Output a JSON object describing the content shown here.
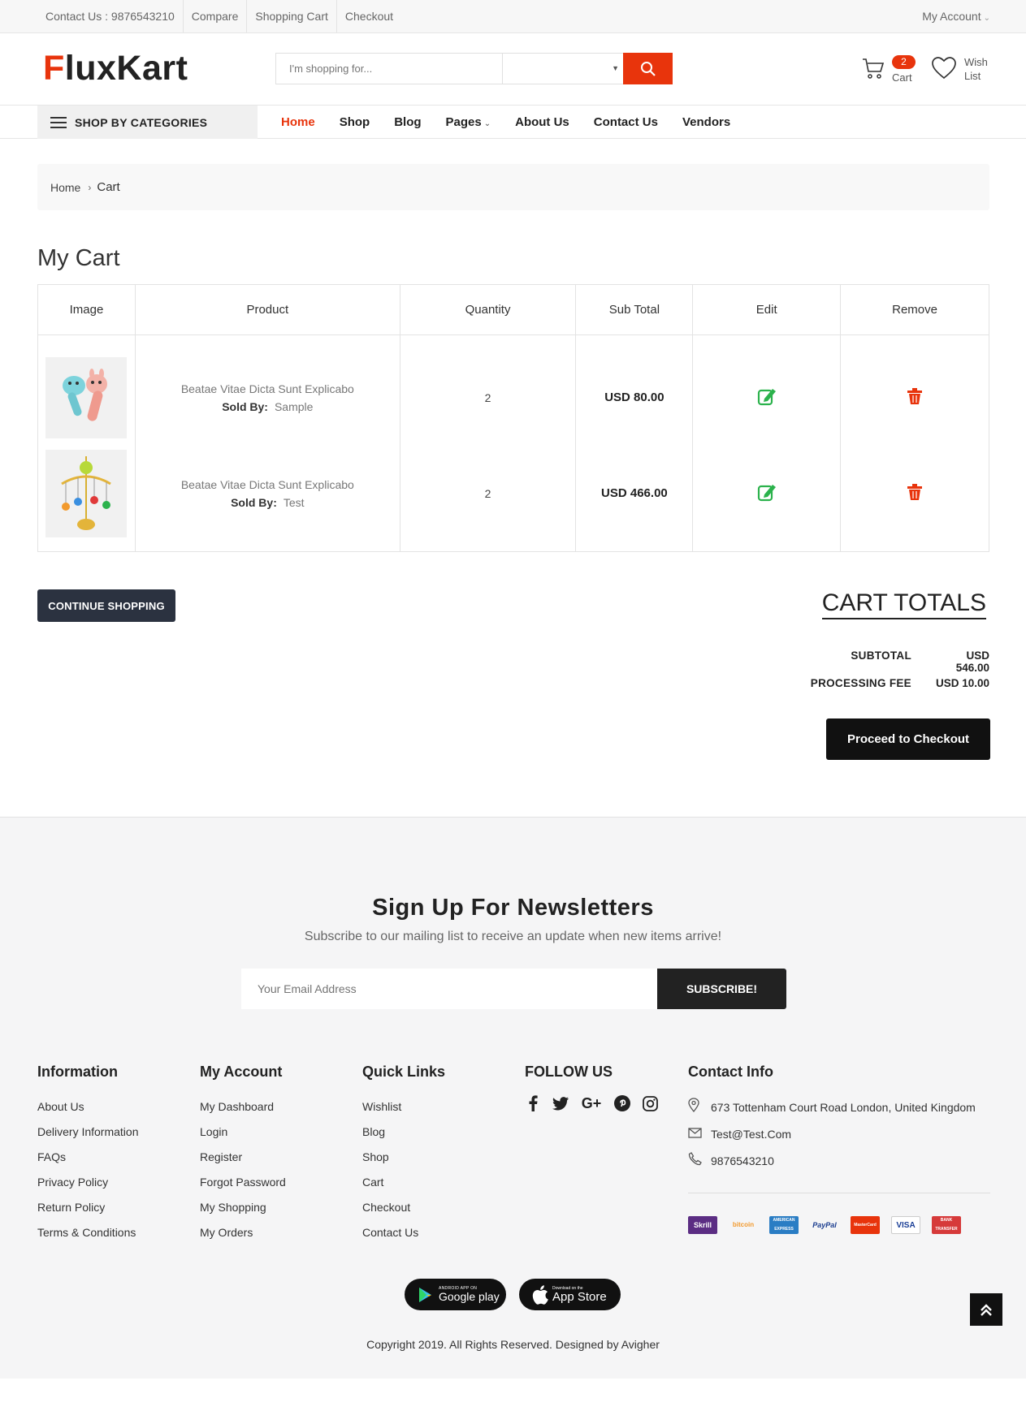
{
  "topbar": {
    "links": [
      "Contact Us : 9876543210",
      "Compare",
      "Shopping Cart",
      "Checkout"
    ],
    "account": "My Account"
  },
  "header": {
    "logo_first": "F",
    "logo_rest": "luxKart",
    "search_placeholder": "I'm shopping for...",
    "cart_count": "2",
    "cart_label": "Cart",
    "wishlist_label": "Wish List"
  },
  "nav": {
    "categories": "SHOP BY CATEGORIES",
    "items": [
      "Home",
      "Shop",
      "Blog",
      "Pages",
      "About Us",
      "Contact Us",
      "Vendors"
    ]
  },
  "breadcrumb": {
    "home": "Home",
    "current": "Cart"
  },
  "page_title": "My Cart",
  "table": {
    "headers": [
      "Image",
      "Product",
      "Quantity",
      "Sub Total",
      "Edit",
      "Remove"
    ],
    "rows": [
      {
        "name": "Beatae Vitae Dicta Sunt Explicabo",
        "sold_by_label": "Sold By:",
        "seller": "Sample",
        "qty": "2",
        "subtotal": "USD 80.00"
      },
      {
        "name": "Beatae Vitae Dicta Sunt Explicabo",
        "sold_by_label": "Sold By:",
        "seller": "Test",
        "qty": "2",
        "subtotal": "USD 466.00"
      }
    ]
  },
  "continue_label": "CONTINUE SHOPPING",
  "totals": {
    "title": "CART TOTALS",
    "subtotal_label": "SUBTOTAL",
    "subtotal": "USD 546.00",
    "fee_label": "PROCESSING FEE",
    "fee": "USD 10.00",
    "checkout_label": "Proceed to Checkout"
  },
  "newsletter": {
    "title": "Sign Up For Newsletters",
    "subtitle": "Subscribe to our mailing list to receive an update when new items arrive!",
    "placeholder": "Your Email Address",
    "button": "SUBSCRIBE!"
  },
  "footer": {
    "information": {
      "title": "Information",
      "links": [
        "About Us",
        "Delivery Information",
        "FAQs",
        "Privacy Policy",
        "Return Policy",
        "Terms & Conditions"
      ]
    },
    "account": {
      "title": "My Account",
      "links": [
        "My Dashboard",
        "Login",
        "Register",
        "Forgot Password",
        "My Shopping",
        "My Orders"
      ]
    },
    "quick": {
      "title": "Quick Links",
      "links": [
        "Wishlist",
        "Blog",
        "Shop",
        "Cart",
        "Checkout",
        "Contact Us"
      ]
    },
    "follow": {
      "title": "FOLLOW US",
      "icons": [
        "facebook-icon",
        "twitter-icon",
        "google-plus-icon",
        "pinterest-icon",
        "instagram-icon"
      ]
    },
    "contact": {
      "title": "Contact Info",
      "address": "673 Tottenham Court Road London, United Kingdom",
      "email": "Test@Test.Com",
      "phone": "9876543210"
    },
    "payments": [
      "Skrill",
      "bitcoin",
      "AMERICAN EXPRESS",
      "PayPal",
      "MasterCard",
      "VISA",
      "BANK TRANSFER"
    ],
    "google_small": "ANDROID APP ON",
    "google_big": "Google play",
    "apple_small": "Download on the",
    "apple_big": "App Store",
    "copyright": "Copyright 2019. All Rights Reserved. Designed by Avigher"
  },
  "colors": {
    "accent": "#e8340c",
    "edit": "#2bb24c",
    "remove": "#e8340c",
    "dark_button": "#2b3240"
  }
}
